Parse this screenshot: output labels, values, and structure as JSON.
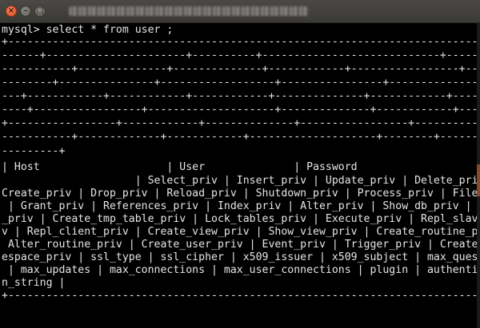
{
  "window": {
    "close_symbol": "×",
    "minimize_symbol": "–",
    "maximize_symbol": "□"
  },
  "terminal": {
    "prompt_line": "mysql> select * from user ;",
    "lines": [
      "+-------------------------------------------------------------------------------------------------------",
      "------+----------------------+----------+----------------------------+----------------+---------------+",
      "-----------+--------------+--------------+------------+-----------------+--------+------------------+----",
      "--------+---------------+------------------+----------------+---------------+-------------+-------------",
      "---+------------+------------+------------+--------------+------------+---------------+-----------------",
      "----+-----------------+--------------------+--------------+------------+----------------+-------------",
      "+-----------------+------------+--------------+-----------------+--------------+-------------+--------+",
      "-----------+-------------+------------+--------------------+--------+------------------------------------",
      "---------+",
      "| Host                    | User              | Password",
      "                     | Select_priv | Insert_priv | Update_priv | Delete_priv |",
      "Create_priv | Drop_priv | Reload_priv | Shutdown_priv | Process_priv | File_priv",
      " | Grant_priv | References_priv | Index_priv | Alter_priv | Show_db_priv | Super",
      "_priv | Create_tmp_table_priv | Lock_tables_priv | Execute_priv | Repl_slave_pri",
      "v | Repl_client_priv | Create_view_priv | Show_view_priv | Create_routine_priv |",
      " Alter_routine_priv | Create_user_priv | Event_priv | Trigger_priv | Create_tabl",
      "espace_priv | ssl_type | ssl_cipher | x509_issuer | x509_subject | max_questions",
      " | max_updates | max_connections | max_user_connections | plugin | authentication",
      "n_string |",
      "+-------------------------------------------------------------------------------------------------------"
    ]
  }
}
